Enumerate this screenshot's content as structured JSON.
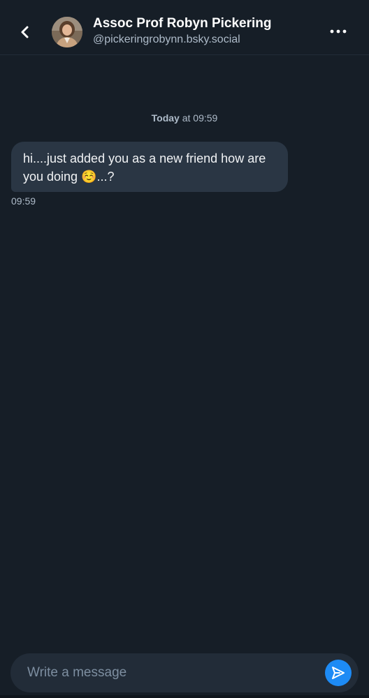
{
  "header": {
    "display_name": "Assoc Prof Robyn Pickering",
    "handle": "@pickeringrobynn.bsky.social",
    "back_icon": "chevron-left-icon",
    "more_icon": "more-horizontal-icon"
  },
  "conversation": {
    "date_separator": {
      "day": "Today",
      "rest": " at 09:59"
    },
    "messages": [
      {
        "text": "hi....just added you as a new friend how are you doing ☺️...?",
        "time": "09:59"
      }
    ]
  },
  "composer": {
    "placeholder": "Write a message",
    "value": "",
    "send_icon": "send-icon"
  },
  "colors": {
    "background": "#161e27",
    "bubble": "#2a3644",
    "accent": "#1d8bf5",
    "muted_text": "#aebbc9"
  }
}
